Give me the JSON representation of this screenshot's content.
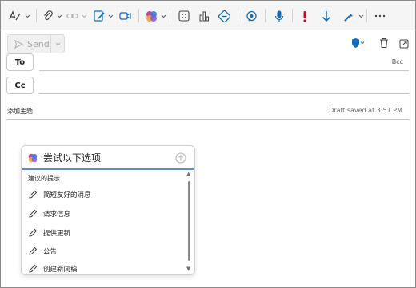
{
  "toolbar": {
    "buttons": [
      "format-painter",
      "attach",
      "link",
      "signature",
      "meeting",
      "copilot",
      "apps",
      "insights",
      "reactions",
      "immersive-reader",
      "dictate",
      "importance",
      "low-importance",
      "sensitivity",
      "more"
    ],
    "accent": "#0f6cbd",
    "importance_color": "#c50f1f"
  },
  "compose": {
    "send_label": "Send",
    "to_label": "To",
    "cc_label": "Cc",
    "bcc_label": "Bcc",
    "subject_placeholder": "添加主题",
    "draft_status": "Draft saved at 3:51 PM"
  },
  "copilot": {
    "prompt_text": "尝试以下选项",
    "suggestions_title": "建议的提示",
    "suggestions": [
      {
        "label": "简短友好的消息"
      },
      {
        "label": "请求信息"
      },
      {
        "label": "提供更新"
      },
      {
        "label": "公告"
      },
      {
        "label": "创建新闻稿"
      }
    ]
  }
}
